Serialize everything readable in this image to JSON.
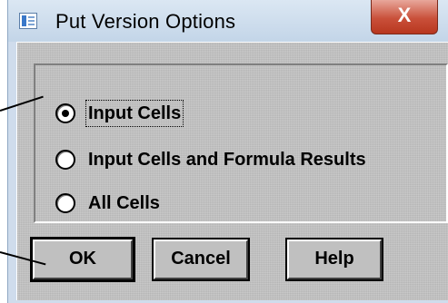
{
  "window": {
    "title": "Put Version Options",
    "close_label": "X"
  },
  "options": [
    {
      "label": "Input Cells",
      "checked": true
    },
    {
      "label": "Input Cells and Formula Results",
      "checked": false
    },
    {
      "label": "All Cells",
      "checked": false
    }
  ],
  "buttons": {
    "ok": "OK",
    "cancel": "Cancel",
    "help": "Help"
  }
}
